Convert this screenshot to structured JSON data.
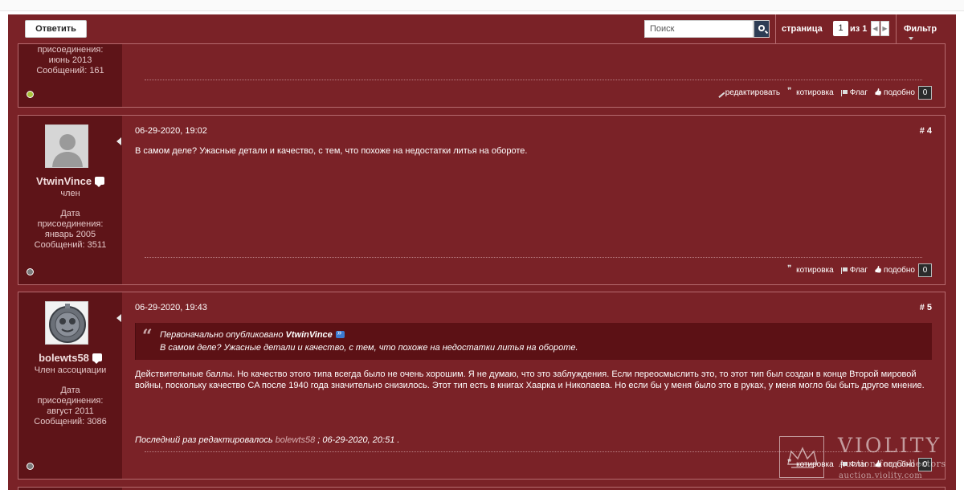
{
  "toolbar": {
    "reply_label": "Ответить",
    "search_placeholder": "Поиск",
    "page_label": "страница",
    "page_current": "1",
    "page_of": "из 1",
    "filter_label": "Фильтр"
  },
  "icons": {
    "prev": "◀",
    "next": "▶"
  },
  "post_prev": {
    "meta_lines": [
      "присоединения:",
      "июнь 2013",
      "Сообщений: 161"
    ],
    "actions": {
      "edit": "редактировать",
      "quote": "котировка",
      "flag": "Флаг",
      "like": "подобно",
      "like_count": "0"
    }
  },
  "post4": {
    "username": "VtwinVince",
    "role": "член",
    "join_label": "Дата присоединения:",
    "join_date": "январь 2005",
    "posts": "Сообщений: 3511",
    "date": "06-29-2020, 19:02",
    "number": "# 4",
    "text": "В самом деле? Ужасные детали и качество, с тем, что похоже на недостатки литья на обороте.",
    "actions": {
      "quote": "котировка",
      "flag": "Флаг",
      "like": "подобно",
      "like_count": "0"
    }
  },
  "post5": {
    "username": "bolewts58",
    "role": "Член ассоциации",
    "join_label": "Дата присоединения:",
    "join_date": "август 2011",
    "posts": "Сообщений: 3086",
    "date": "06-29-2020, 19:43",
    "number": "# 5",
    "quote": {
      "mark": "“",
      "originally": "Первоначально опубликовано",
      "author": "VtwinVince",
      "text": "В самом деле? Ужасные детали и качество, с тем, что похоже на недостатки литья на обороте."
    },
    "text": "Действительные баллы. Но качество этого типа всегда было не очень хорошим. Я не думаю, что это заблуждения. Если переосмыслить это, то этот тип был создан в конце Второй мировой войны, поскольку качество CA после 1940 года значительно снизилось. Этот тип есть в книгах Хаарка и Николаева. Но если бы у меня было это в руках, у меня могло бы быть другое мнение.",
    "edited_prefix": "Последний раз редактировалось",
    "edited_user": "bolewts58",
    "edited_suffix": "; 06-29-2020, 20:51 .",
    "actions": {
      "quote": "котировка",
      "flag": "Флаг",
      "like": "подобно",
      "like_count": "0"
    }
  },
  "watermark": {
    "title": "VIOLITY",
    "subtitle": "Auction for Collectors",
    "url": "auction.violity.com"
  }
}
